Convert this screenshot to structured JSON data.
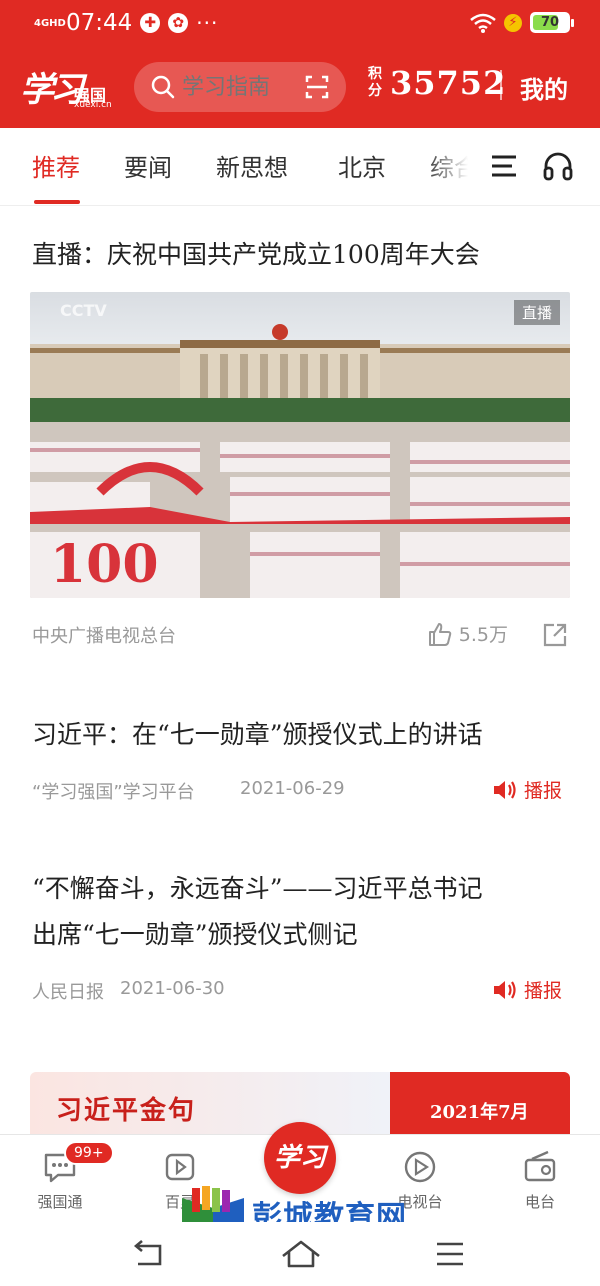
{
  "status_bar": {
    "network": "4GHD",
    "time": "07:44",
    "more": "···",
    "battery_level": "70",
    "battery_fraction": 0.7
  },
  "header": {
    "logo_script": "学习",
    "logo_name": "强国",
    "logo_url": "xuexi.cn",
    "search_placeholder": "学习指南",
    "points_label": "积分",
    "points_value": "35752",
    "mine_label": "我的",
    "accent_color": "#e02a23"
  },
  "tabs": [
    {
      "label": "推荐",
      "active": true
    },
    {
      "label": "要闻",
      "active": false
    },
    {
      "label": "新思想",
      "active": false
    },
    {
      "label": "北京",
      "active": false
    },
    {
      "label": "综合",
      "active": false
    }
  ],
  "feed": [
    {
      "title": "直播：庆祝中国共产党成立100周年大会",
      "live_badge": "直播",
      "source": "中央广播电视总台",
      "likes": "5.5万"
    },
    {
      "title": "习近平：在“七一勋章”颁授仪式上的讲话",
      "source": "“学习强国”学习平台",
      "date": "2021-06-29",
      "broadcast_label": "播报"
    },
    {
      "title_line1": "“不懈奋斗，永远奋斗”——习近平总书记",
      "title_line2": "出席“七一勋章”颁授仪式侧记",
      "source": "人民日报",
      "date": "2021-06-30",
      "broadcast_label": "播报"
    }
  ],
  "banner": {
    "title": "习近平金句",
    "date": "2021年7月"
  },
  "bottom_nav": {
    "items": [
      {
        "label": "强国通",
        "icon": "chat-icon"
      },
      {
        "label": "百灵",
        "icon": "bailing-icon"
      },
      {
        "label": "",
        "icon": "xuexi-logo"
      },
      {
        "label": "电视台",
        "icon": "play-icon"
      },
      {
        "label": "电台",
        "icon": "radio-icon"
      }
    ],
    "badge": "99+",
    "center_label": "学习"
  },
  "watermark": {
    "text": "彭城教育网"
  }
}
